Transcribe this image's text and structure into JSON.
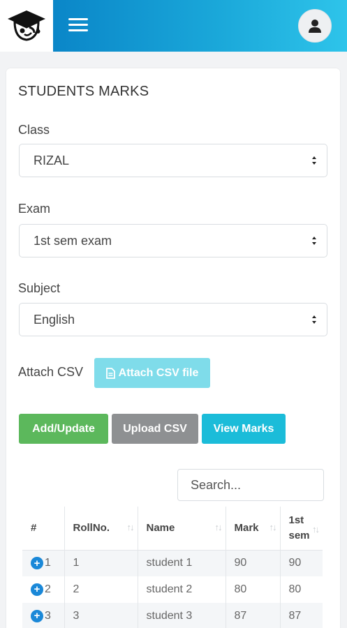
{
  "header": {
    "logo_icon": "graduation-cap-logo",
    "menu_icon": "hamburger-menu-icon",
    "avatar_icon": "user-avatar-icon"
  },
  "page": {
    "title": "STUDENTS MARKS"
  },
  "form": {
    "class_label": "Class",
    "class_value": "RIZAL",
    "exam_label": "Exam",
    "exam_value": "1st sem exam",
    "subject_label": "Subject",
    "subject_value": "English",
    "attach_label": "Attach CSV",
    "attach_button": "Attach CSV file"
  },
  "actions": {
    "add_update": "Add/Update",
    "upload_csv": "Upload CSV",
    "view_marks": "View Marks"
  },
  "search": {
    "placeholder": "Search..."
  },
  "table": {
    "headers": [
      "#",
      "RollNo.",
      "Name",
      "Mark",
      "1st sem"
    ],
    "rows": [
      {
        "index": "1",
        "roll": "1",
        "name": "student 1",
        "mark": "90",
        "sem": "90"
      },
      {
        "index": "2",
        "roll": "2",
        "name": "student 2",
        "mark": "80",
        "sem": "80"
      },
      {
        "index": "3",
        "roll": "3",
        "name": "student 3",
        "mark": "87",
        "sem": "87"
      }
    ]
  },
  "colors": {
    "header_gradient_start": "#0a86c8",
    "header_gradient_end": "#2ec4ea",
    "green": "#5cb85c",
    "gray": "#8e9092",
    "cyan": "#1bbcd9",
    "attach": "#7fdcea"
  }
}
